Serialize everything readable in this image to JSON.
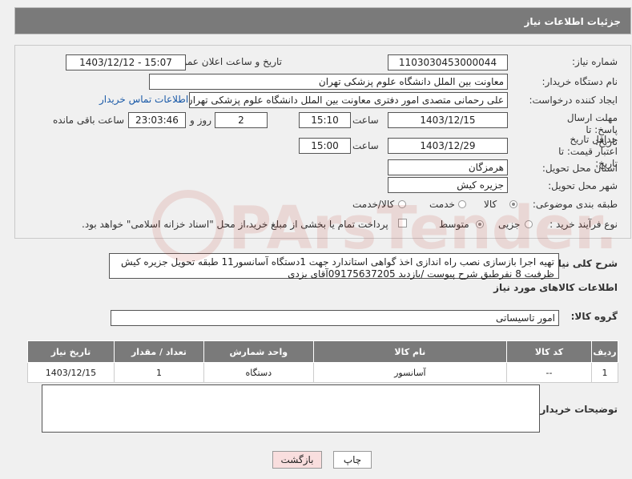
{
  "header": {
    "title": "جزئیات اطلاعات نیاز"
  },
  "form": {
    "need_number_label": "شماره نیاز:",
    "need_number": "1103030453000044",
    "announce_label": "تاریخ و ساعت اعلان عمومی:",
    "announce_value": "1403/12/12 - 15:07",
    "buyer_org_label": "نام دستگاه خریدار:",
    "buyer_org": "معاونت بین الملل دانشگاه علوم پزشکی تهران",
    "creator_label": "ایجاد کننده درخواست:",
    "creator": "علی رحمانی متصدی امور دفتری معاونت بین الملل دانشگاه علوم پزشکی تهران",
    "contact_link": "اطلاعات تماس خریدار",
    "reply_deadline_label": "مهلت ارسال پاسخ: تا تاریخ:",
    "reply_date": "1403/12/15",
    "time_label": "ساعت",
    "reply_time": "15:10",
    "days_value": "2",
    "days_label": "روز و",
    "remaining_time": "23:03:46",
    "remaining_label": "ساعت باقی مانده",
    "price_validity_label": "حداقل تاریخ اعتبار قیمت: تا تاریخ:",
    "price_date": "1403/12/29",
    "price_time": "15:00",
    "province_label": "استان محل تحویل:",
    "province": "هرمزگان",
    "city_label": "شهر محل تحویل:",
    "city": "جزیره کیش",
    "category_label": "طبقه بندی موضوعی:",
    "category_options": [
      "کالا",
      "خدمت",
      "کالا/خدمت"
    ],
    "category_selected": "کالا",
    "process_label": "نوع فرآیند خرید :",
    "process_options": [
      "جزیی",
      "متوسط"
    ],
    "process_selected": "متوسط",
    "payment_note": "پرداخت تمام یا بخشی از مبلغ خرید،از محل \"اسناد خزانه اسلامی\" خواهد بود."
  },
  "description": {
    "label": "شرح کلی نیاز:",
    "text": "تهیه اجرا بازسازی نصب راه اندازی اخذ گواهی استاندارد جهت 1دستگاه آسانسور11 طبقه تحویل جزیره کیش ظرفیت 8 نفرطبق شرح پیوست /بازدید 09175637205آقای یزدی"
  },
  "goods": {
    "section_title": "اطلاعات کالاهای مورد نیاز",
    "group_label": "گروه کالا:",
    "group_value": "امور تاسیساتی",
    "columns": [
      "ردیف",
      "کد کالا",
      "نام کالا",
      "واحد شمارش",
      "تعداد / مقدار",
      "تاریخ نیاز"
    ],
    "rows": [
      {
        "row": "1",
        "code": "--",
        "name": "آسانسور",
        "unit": "دستگاه",
        "qty": "1",
        "date": "1403/12/15"
      }
    ]
  },
  "buyer_notes": {
    "label": "توضیحات خریدار:",
    "value": ""
  },
  "buttons": {
    "print": "چاپ",
    "back": "بازگشت"
  },
  "watermark": {
    "text": "PArsTender.net"
  },
  "colors": {
    "header_bg": "#7a7a7a",
    "link": "#1a5aa8",
    "back_button_bg": "#f9dede",
    "watermark": "#c0392b"
  }
}
